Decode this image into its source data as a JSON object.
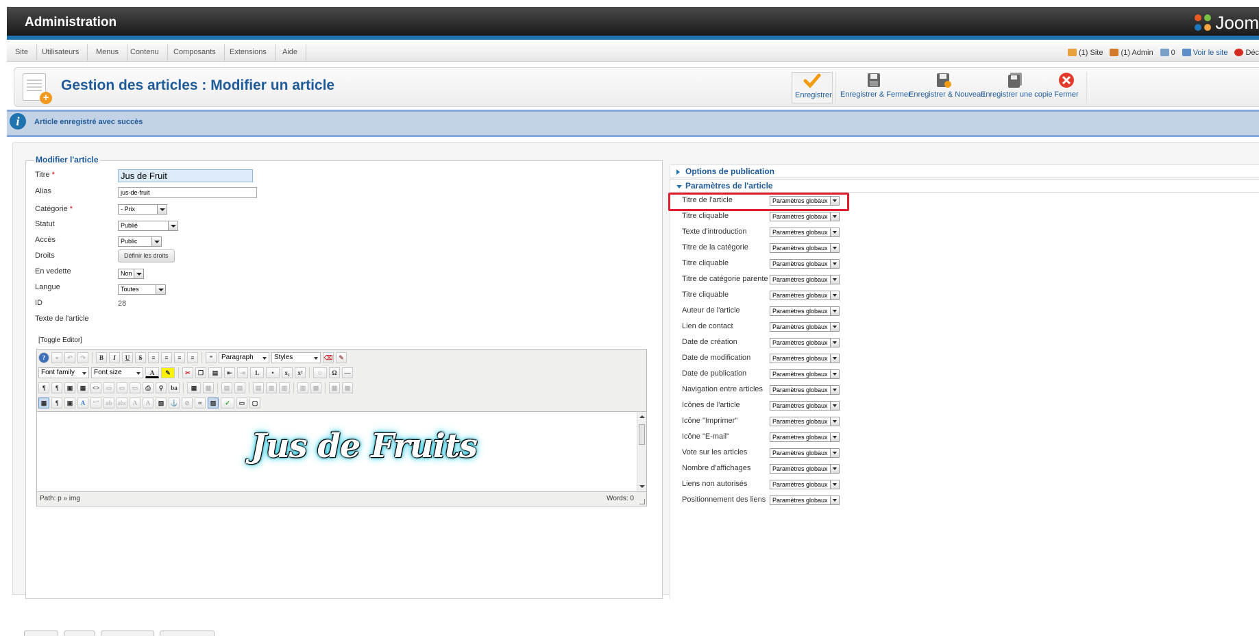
{
  "header": {
    "title": "Administration",
    "logo_text": "Joom"
  },
  "menu": {
    "items": [
      "Site",
      "Utilisateurs",
      "Menus",
      "Contenu",
      "Composants",
      "Extensions",
      "Aide"
    ],
    "status": {
      "site": "(1) Site",
      "admin": "(1) Admin",
      "messages": "0",
      "view_site": "Voir le site",
      "logout": "Déc"
    }
  },
  "toolbar": {
    "page_title": "Gestion des articles : Modifier un article",
    "buttons": {
      "save": "Enregistrer",
      "save_close": "Enregistrer & Fermer",
      "save_new": "Enregistrer & Nouveau",
      "save_copy": "Enregistrer une copie",
      "close": "Fermer"
    }
  },
  "message": {
    "text": "Article enregistré avec succès"
  },
  "form": {
    "legend": "Modifier l'article",
    "fields": {
      "title_label": "Titre",
      "title_value": "Jus de Fruit",
      "alias_label": "Alias",
      "alias_value": "jus-de-fruit",
      "category_label": "Catégorie",
      "category_value": "- Prix",
      "status_label": "Statut",
      "status_value": "Publié",
      "access_label": "Accès",
      "access_value": "Public",
      "rights_label": "Droits",
      "rights_button": "Définir les droits",
      "featured_label": "En vedette",
      "featured_value": "Non",
      "language_label": "Langue",
      "language_value": "Toutes",
      "id_label": "ID",
      "id_value": "28",
      "text_label": "Texte de l'article"
    },
    "required_mark": "*"
  },
  "editor": {
    "toggle": "[Toggle Editor]",
    "format_select": "Paragraph",
    "styles_select": "Styles",
    "font_family": "Font family",
    "font_size": "Font size",
    "content_image_text": "Jus de Fruits",
    "path": "Path:  p » img",
    "words": "Words: 0"
  },
  "right": {
    "publishing_options": "Options de publication",
    "article_params": "Paramètres de l'article",
    "param_value": "Paramètres globaux",
    "params": [
      "Titre de l'article",
      "Titre cliquable",
      "Texte d'introduction",
      "Titre de la catégorie",
      "Titre cliquable",
      "Titre de catégorie parente",
      "Titre cliquable",
      "Auteur de l'article",
      "Lien de contact",
      "Date de création",
      "Date de modification",
      "Date de publication",
      "Navigation entre articles",
      "Icônes de l'article",
      "Icône \"Imprimer\"",
      "Icône \"E-mail\"",
      "Vote sur les articles",
      "Nombre d'affichages",
      "Liens non autorisés",
      "Positionnement des liens"
    ]
  },
  "colors": {
    "brand_blue": "#1f5b99",
    "header_bar": "#1f74b0",
    "highlight_red": "#e01e2e",
    "message_bg": "#c3d2e5"
  }
}
